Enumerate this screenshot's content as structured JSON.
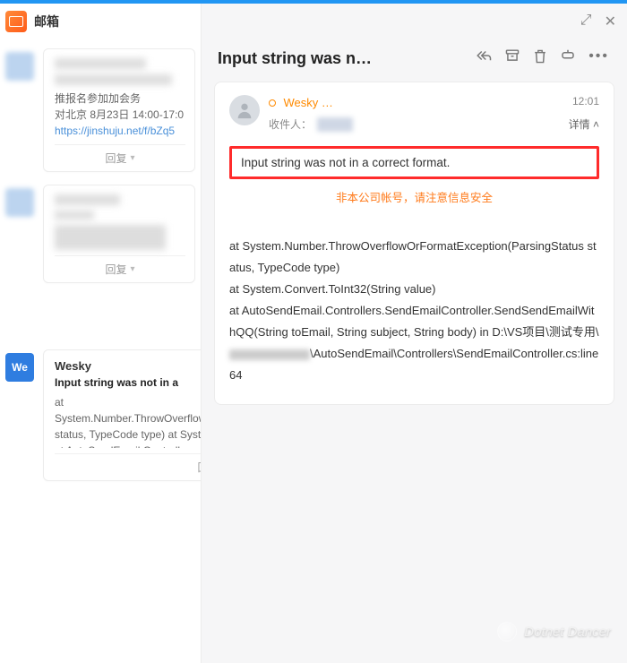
{
  "app": {
    "name": "邮箱"
  },
  "window": {
    "expand_label": "expand-icon",
    "close_label": "close-icon"
  },
  "sidebar": {
    "items": [
      {
        "preview_lines": [
          "推报名参加加会务",
          "对北京  8月23日 14:00-17:0",
          "https://jinshuju.net/f/bZq5"
        ],
        "reply": "回复"
      },
      {
        "reply": "回复"
      },
      {
        "avatar_text": "We",
        "name": "Wesky",
        "subject": "Input string was not in a",
        "preview": "at System.Number.ThrowOverflowOrFormatException(ParsingStatus status, TypeCode type) at System.Convert.ToInt32(String value) at AutoSendEmail.Controllers",
        "reply": "回复"
      }
    ]
  },
  "mail": {
    "title": "Input string was n…",
    "toolbar": {
      "reply_all": "reply-all-icon",
      "archive": "archive-icon",
      "delete": "delete-icon",
      "pin": "pin-icon",
      "more": "more-icon"
    },
    "sender": "Wesky …",
    "time": "12:01",
    "recipients_label": "收件人：",
    "detail_toggle": "详情 ",
    "highlight": "Input string was not in a correct format.",
    "warning": "非本公司帐号，请注意信息安全",
    "stack": {
      "l1": "   at System.Number.ThrowOverflowOrFormatException(ParsingStatus status, TypeCode type)",
      "l2": "   at System.Convert.ToInt32(String value)",
      "l3a": "   at AutoSendEmail.Controllers.SendEmailController.SendSendEmailWithQQ(String toEmail, String subject, String body) in D:\\VS项目\\测试专用\\",
      "l3b": "\\AutoSendEmail\\Controllers\\SendEmailController.cs:line 64"
    }
  },
  "watermark": "Dotnet Dancer"
}
